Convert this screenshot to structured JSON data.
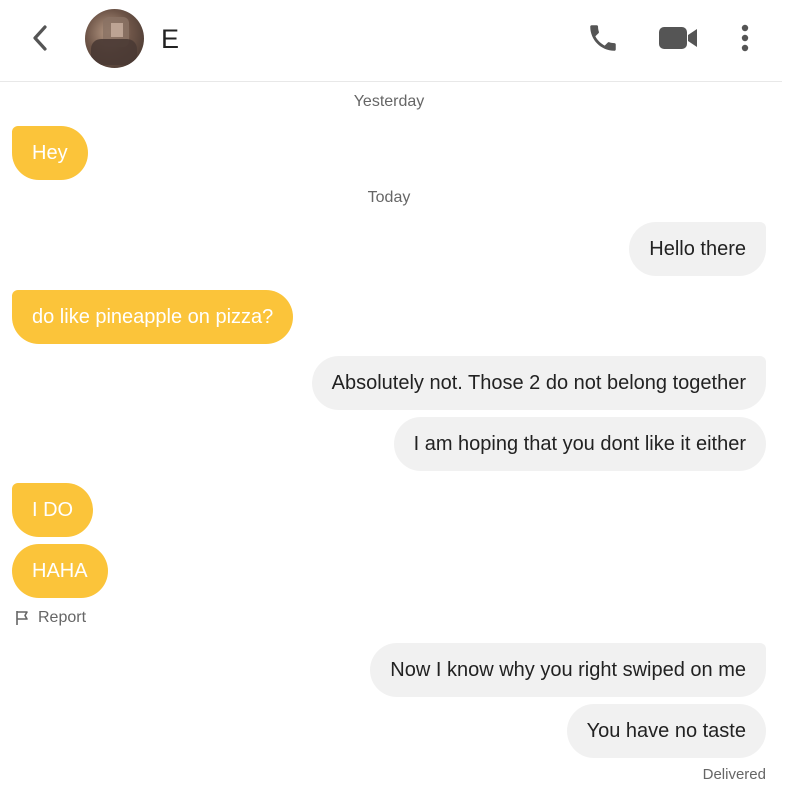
{
  "header": {
    "back_icon": "chevron-left-icon",
    "contact_name": "E",
    "phone_icon": "phone-icon",
    "video_icon": "video-camera-icon",
    "more_icon": "more-vertical-icon"
  },
  "dates": {
    "yesterday": "Yesterday",
    "today": "Today"
  },
  "messages": [
    {
      "from": "them",
      "text": "Hey"
    },
    {
      "from": "me",
      "text": "Hello there"
    },
    {
      "from": "them",
      "text": "do like pineapple on pizza?"
    },
    {
      "from": "me",
      "text": "Absolutely not. Those 2 do not belong together"
    },
    {
      "from": "me",
      "text": "I am hoping that you dont like it either"
    },
    {
      "from": "them",
      "text": "I DO"
    },
    {
      "from": "them",
      "text": "HAHA"
    },
    {
      "from": "me",
      "text": "Now I know why you right swiped on me"
    },
    {
      "from": "me",
      "text": "You have no taste"
    }
  ],
  "report_label": "Report",
  "status": "Delivered",
  "colors": {
    "incoming_bubble": "#fbc43a",
    "outgoing_bubble": "#f1f1f1",
    "icon": "#555555"
  }
}
